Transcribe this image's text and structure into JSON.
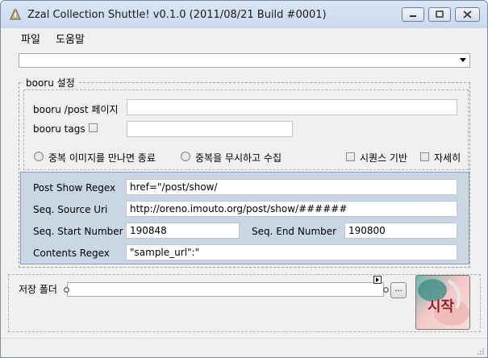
{
  "window": {
    "title": "Zzal Collection Shuttle! v0.1.0 (2011/08/21 Build #0001)",
    "icon": "app-icon"
  },
  "menu": {
    "file": "파일",
    "help": "도움말"
  },
  "booru": {
    "group_label": "booru 설정",
    "post_page_label": "booru /post 페이지",
    "post_page_value": "",
    "tags_label": "booru tags",
    "tags_value": "",
    "tags_checked": false,
    "radio_stop": "중복 이미지를 만나면 종료",
    "radio_ignore": "중복을 무시하고 수집",
    "seq_based": "시퀀스 기반",
    "verbose": "자세히"
  },
  "regex": {
    "post_show_label": "Post Show Regex",
    "post_show_value": "href=\"/post/show/",
    "seq_source_label": "Seq. Source Uri",
    "seq_source_value": "http://oreno.imouto.org/post/show/######",
    "seq_start_label": "Seq. Start Number",
    "seq_start_value": "190848",
    "seq_end_label": "Seq. End Number",
    "seq_end_value": "190800",
    "contents_label": "Contents Regex",
    "contents_value": "\"sample_url\":\""
  },
  "save": {
    "folder_label": "저장 폴더",
    "folder_value": "",
    "browse_label": "...",
    "start_label": "시작"
  },
  "colors": {
    "regex_panel": "#c9d6e3",
    "title_bar": "#dbe6f4"
  }
}
